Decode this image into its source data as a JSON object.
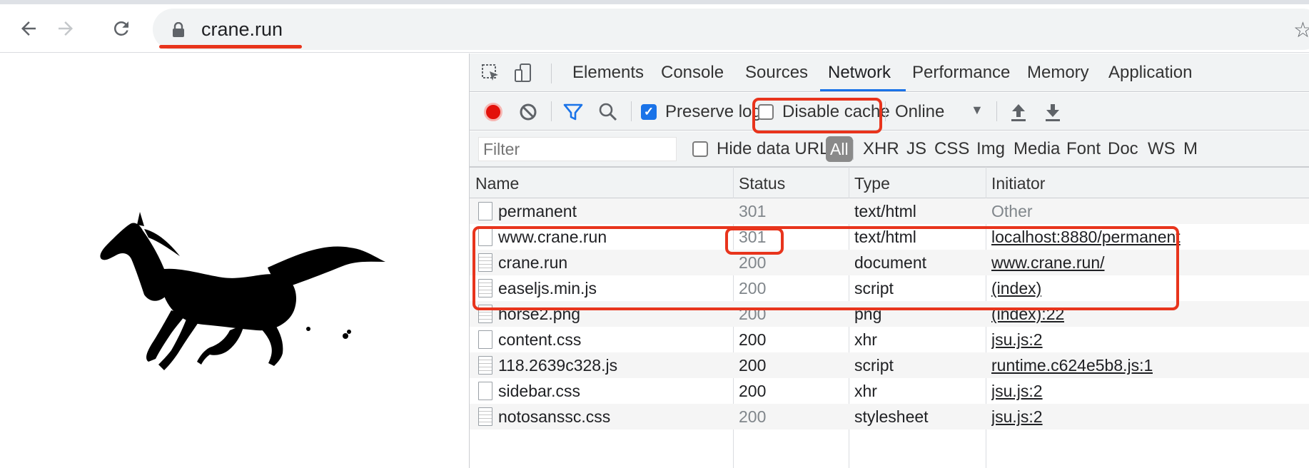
{
  "browser": {
    "url": "crane.run"
  },
  "devtools": {
    "tabs": [
      "Elements",
      "Console",
      "Sources",
      "Network",
      "Performance",
      "Memory",
      "Application"
    ],
    "active_tab": "Network",
    "controls": {
      "preserve_log_label": "Preserve log",
      "preserve_log_checked": true,
      "disable_cache_label": "Disable cache",
      "disable_cache_checked": false,
      "throttle": "Online"
    },
    "filter": {
      "placeholder": "Filter",
      "hide_data_urls_label": "Hide data URLs",
      "types": [
        "All",
        "XHR",
        "JS",
        "CSS",
        "Img",
        "Media",
        "Font",
        "Doc",
        "WS",
        "M"
      ]
    },
    "columns": [
      "Name",
      "Status",
      "Type",
      "Initiator"
    ],
    "rows": [
      {
        "name": "permanent",
        "status": "301",
        "type": "text/html",
        "initiator": "Other"
      },
      {
        "name": "www.crane.run",
        "status": "301",
        "type": "text/html",
        "initiator": "localhost:8880/permanent"
      },
      {
        "name": "crane.run",
        "status": "200",
        "type": "document",
        "initiator": "www.crane.run/"
      },
      {
        "name": "easeljs.min.js",
        "status": "200",
        "type": "script",
        "initiator": "(index)"
      },
      {
        "name": "horse2.png",
        "status": "200",
        "type": "png",
        "initiator": "(index):22"
      },
      {
        "name": "content.css",
        "status": "200",
        "type": "xhr",
        "initiator": "jsu.js:2"
      },
      {
        "name": "118.2639c328.js",
        "status": "200",
        "type": "script",
        "initiator": "runtime.c624e5b8.js:1"
      },
      {
        "name": "sidebar.css",
        "status": "200",
        "type": "xhr",
        "initiator": "jsu.js:2"
      },
      {
        "name": "notosanssc.css",
        "status": "200",
        "type": "stylesheet",
        "initiator": "jsu.js:2"
      }
    ]
  },
  "colors": {
    "highlight_red": "#e8341c",
    "accent_blue": "#1a73e8",
    "record_red": "#e3120b"
  }
}
